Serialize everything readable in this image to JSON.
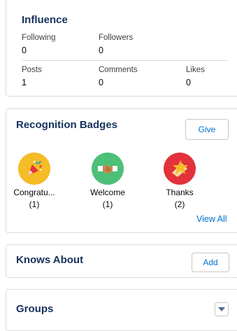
{
  "influence": {
    "title": "Influence",
    "row1": [
      {
        "label": "Following",
        "value": "0"
      },
      {
        "label": "Followers",
        "value": "0"
      }
    ],
    "row2": [
      {
        "label": "Posts",
        "value": "1"
      },
      {
        "label": "Comments",
        "value": "0"
      },
      {
        "label": "Likes",
        "value": "0"
      }
    ]
  },
  "recognition": {
    "title": "Recognition Badges",
    "give_label": "Give",
    "view_all_label": "View All",
    "badges": [
      {
        "name": "Congratu...",
        "count": "(1)",
        "icon": "confetti-icon",
        "color": "#f4bc25"
      },
      {
        "name": "Welcome",
        "count": "(1)",
        "icon": "handshake-icon",
        "color": "#4bc076"
      },
      {
        "name": "Thanks",
        "count": "(2)",
        "icon": "star-icon",
        "color": "#e3323b"
      }
    ]
  },
  "knows_about": {
    "title": "Knows About",
    "add_label": "Add"
  },
  "groups": {
    "title": "Groups",
    "dropdown_icon": "chevron-down-icon"
  },
  "colors": {
    "link": "#0070d2",
    "text": "#16325c",
    "border": "#dddbda"
  }
}
